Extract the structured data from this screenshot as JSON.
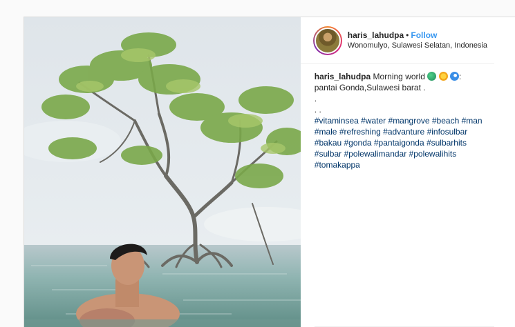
{
  "post": {
    "username": "haris_lahudpa",
    "separator": "•",
    "follow_label": "Follow",
    "location": "Wonomulyo, Sulawesi Selatan, Indonesia",
    "caption": {
      "username": "haris_lahudpa",
      "text_line1": "Morning world",
      "emoji_icons": [
        "globe-icon",
        "sun-icon",
        "wave-icon"
      ],
      "colon": ":",
      "text_line2": "pantai Gonda,Sulawesi barat .",
      "dot_line1": ".",
      "dot_line2": ". .",
      "hashtag_lines": [
        "#vitaminsea #water #mangrove #beach #man",
        "#male #refreshing #advanture #infosulbar",
        "#bakau #gonda #pantaigonda #sulbarhits",
        "#sulbar #polewalimandar #polewalihits",
        "#tomakappa"
      ]
    }
  },
  "colors": {
    "follow": "#3897f0",
    "hashtag": "#003569",
    "border": "#dbdbdb"
  }
}
